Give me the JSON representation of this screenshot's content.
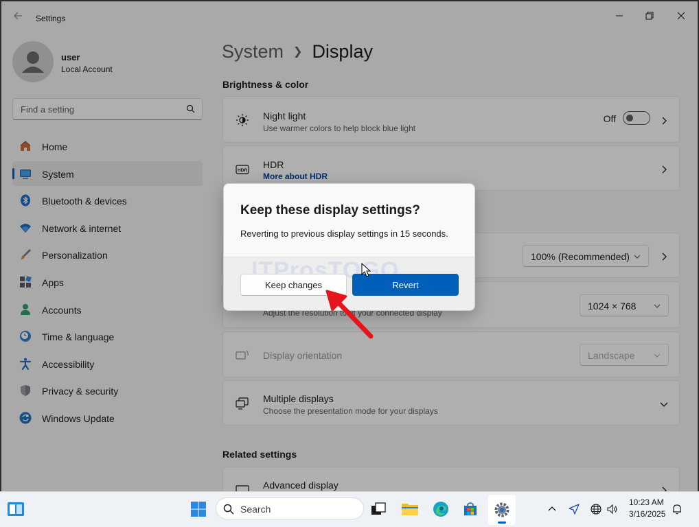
{
  "window": {
    "app_title": "Settings"
  },
  "profile": {
    "name": "user",
    "account_type": "Local Account"
  },
  "search": {
    "placeholder": "Find a setting"
  },
  "sidebar": {
    "items": [
      {
        "label": "Home",
        "icon": "home-icon",
        "active": false
      },
      {
        "label": "System",
        "icon": "system-icon",
        "active": true
      },
      {
        "label": "Bluetooth & devices",
        "icon": "bluetooth-icon",
        "active": false
      },
      {
        "label": "Network & internet",
        "icon": "wifi-icon",
        "active": false
      },
      {
        "label": "Personalization",
        "icon": "brush-icon",
        "active": false
      },
      {
        "label": "Apps",
        "icon": "apps-icon",
        "active": false
      },
      {
        "label": "Accounts",
        "icon": "accounts-icon",
        "active": false
      },
      {
        "label": "Time & language",
        "icon": "clock-globe-icon",
        "active": false
      },
      {
        "label": "Accessibility",
        "icon": "accessibility-icon",
        "active": false
      },
      {
        "label": "Privacy & security",
        "icon": "shield-icon",
        "active": false
      },
      {
        "label": "Windows Update",
        "icon": "update-icon",
        "active": false
      }
    ]
  },
  "main": {
    "breadcrumb_parent": "System",
    "breadcrumb_current": "Display",
    "section_brightness": "Brightness & color",
    "night_light": {
      "title": "Night light",
      "subtitle": "Use warmer colors to help block blue light",
      "toggle_label": "Off",
      "enabled": false
    },
    "hdr": {
      "title": "HDR",
      "link": "More about HDR"
    },
    "scale": {
      "value": "100% (Recommended)"
    },
    "resolution": {
      "subtitle": "Adjust the resolution to fit your connected display",
      "value": "1024 × 768"
    },
    "orientation": {
      "title": "Display orientation",
      "value": "Landscape"
    },
    "multiple_displays": {
      "title": "Multiple displays",
      "subtitle": "Choose the presentation mode for your displays"
    },
    "section_related": "Related settings",
    "advanced_display": {
      "title": "Advanced display"
    }
  },
  "dialog": {
    "title": "Keep these display settings?",
    "message": "Reverting to previous display settings in 15 seconds.",
    "keep_label": "Keep changes",
    "revert_label": "Revert",
    "accent": "#005fb8"
  },
  "taskbar": {
    "search_placeholder": "Search",
    "time": "10:23 AM",
    "date": "3/16/2025"
  },
  "colors": {
    "accent": "#005fb8",
    "annotation_arrow": "#e8141b"
  }
}
